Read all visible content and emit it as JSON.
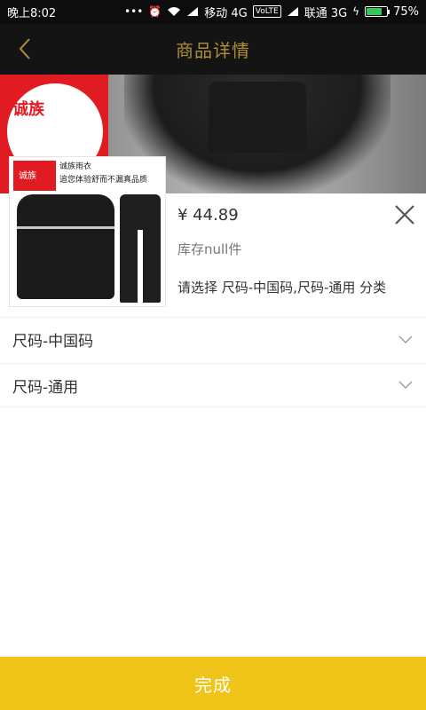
{
  "status_bar": {
    "time": "晚上8:02",
    "carrier1": "移动 4G",
    "volte": "VoLTE",
    "carrier2": "联通 3G",
    "battery": "75%",
    "battery_level": 0.75
  },
  "nav": {
    "title": "商品详情",
    "title_color": "#b08f34",
    "back_icon": "chevron-left-icon"
  },
  "hero": {
    "logo_text": "诚族"
  },
  "product": {
    "thumb_logo_text": "诚族",
    "thumb_caption_line1": "诚族雨衣",
    "thumb_caption_line2": "追您体验舒而不漏真品质",
    "price": "¥ 44.89",
    "stock": "库存null件",
    "selection": "请选择  尺码-中国码,尺码-通用  分类"
  },
  "options": [
    {
      "label": "尺码-中国码"
    },
    {
      "label": "尺码-通用"
    }
  ],
  "footer": {
    "done_label": "完成",
    "done_color": "#f0c419"
  }
}
